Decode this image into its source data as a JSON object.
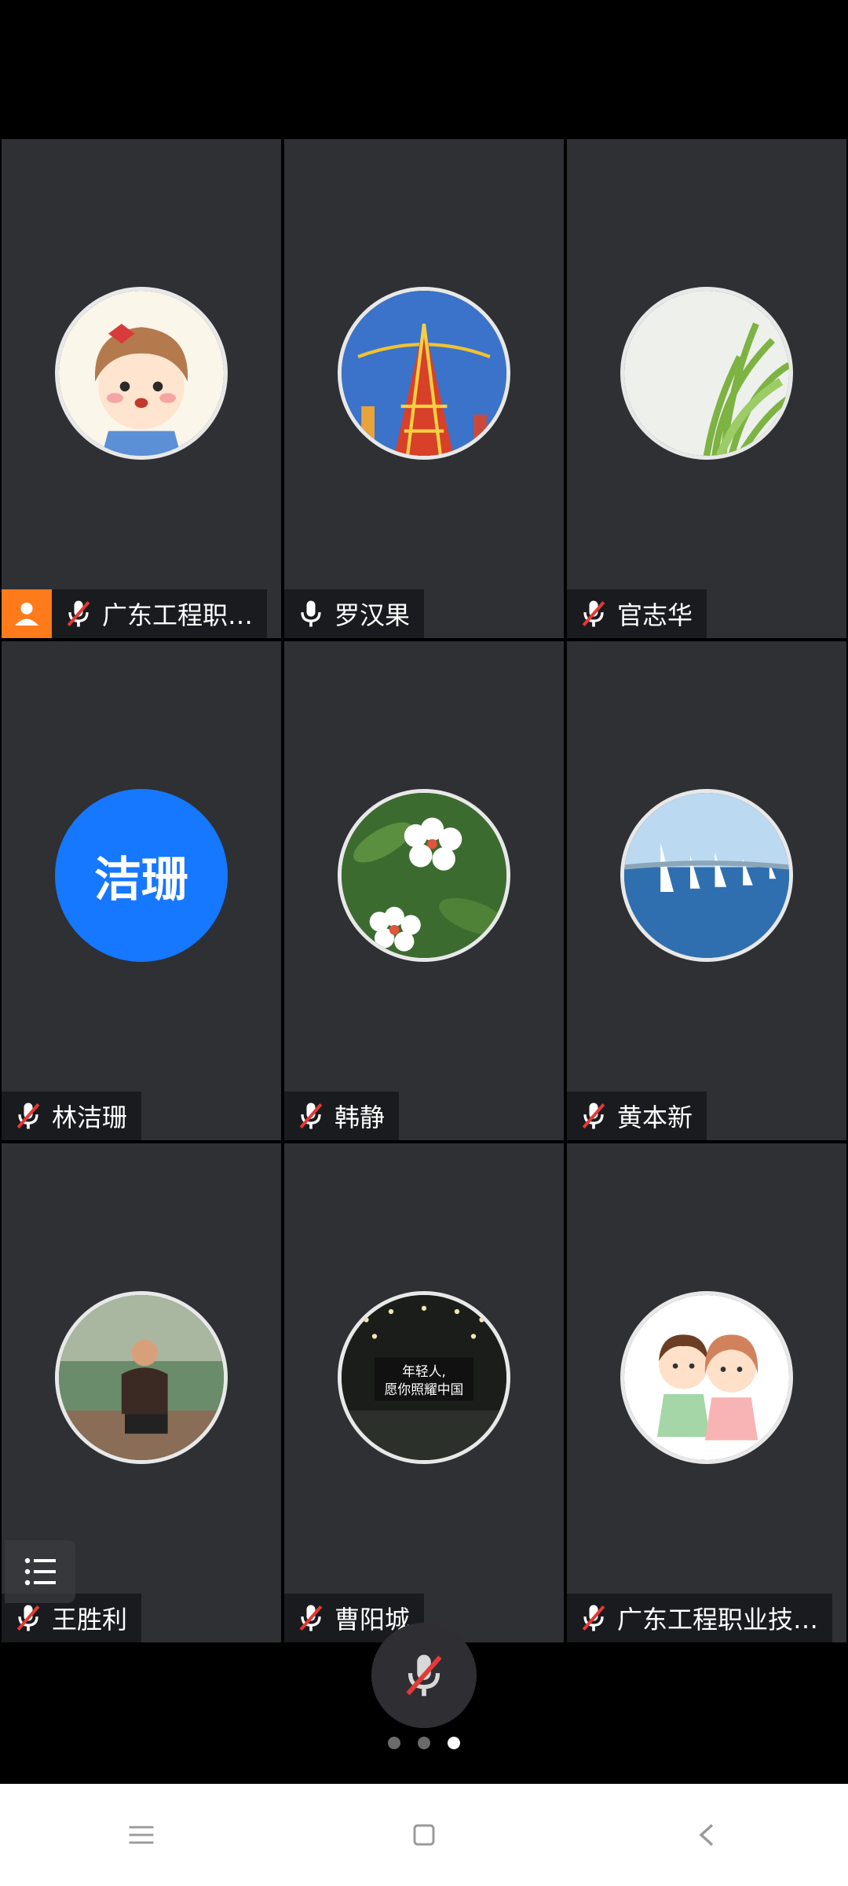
{
  "participants": [
    {
      "name": "广东工程职…",
      "muted": true,
      "host": true,
      "avatar": "cartoon-girl-avatar"
    },
    {
      "name": "罗汉果",
      "muted": false,
      "host": false,
      "avatar": "tower-painting-avatar"
    },
    {
      "name": "官志华",
      "muted": true,
      "host": false,
      "avatar": "grass-avatar"
    },
    {
      "name": "林洁珊",
      "muted": true,
      "host": false,
      "avatar": "text-avatar",
      "avatar_text": "洁珊",
      "avatar_color": "#1677ff"
    },
    {
      "name": "韩静",
      "muted": true,
      "host": false,
      "avatar": "white-flowers-avatar"
    },
    {
      "name": "黄本新",
      "muted": true,
      "host": false,
      "avatar": "sailboats-avatar"
    },
    {
      "name": "王胜利",
      "muted": true,
      "host": false,
      "avatar": "man-photo-avatar"
    },
    {
      "name": "曹阳城",
      "muted": true,
      "host": false,
      "avatar": "stage-photo-avatar",
      "avatar_caption_1": "年轻人,",
      "avatar_caption_2": "愿你照耀中国"
    },
    {
      "name": "广东工程职业技…",
      "muted": true,
      "host": false,
      "avatar": "cartoon-couple-avatar"
    }
  ],
  "pagination": {
    "total": 3,
    "current": 3
  },
  "colors": {
    "host_badge": "#ff7a1a",
    "tile_bg": "#2e3034",
    "muted_slash": "#e53935"
  },
  "icons": {
    "list": "participant-list-icon",
    "mic_main": "mic-muted-icon",
    "nav_menu": "menu-icon",
    "nav_home": "home-square-icon",
    "nav_back": "back-chevron-icon"
  }
}
